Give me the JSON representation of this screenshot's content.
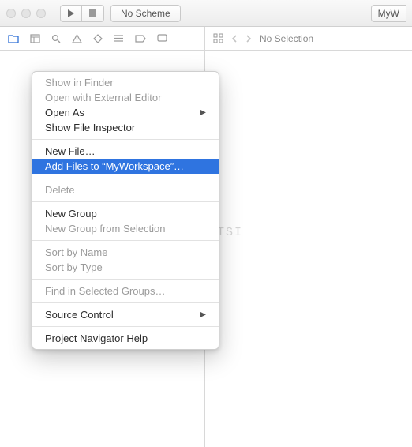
{
  "titlebar": {
    "scheme_label": "No Scheme",
    "right_pill": "MyW"
  },
  "jumpbar": {
    "no_selection": "No Selection"
  },
  "context_menu": {
    "items": [
      {
        "label": "Show in Finder",
        "dim": true
      },
      {
        "label": "Open with External Editor",
        "dim": true
      },
      {
        "label": "Open As",
        "submenu": true
      },
      {
        "label": "Show File Inspector"
      },
      {
        "sep": true
      },
      {
        "label": "New File…"
      },
      {
        "label": "Add Files to “MyWorkspace”…",
        "selected": true
      },
      {
        "sep": true
      },
      {
        "label": "Delete",
        "dim": true
      },
      {
        "sep": true
      },
      {
        "label": "New Group"
      },
      {
        "label": "New Group from Selection",
        "dim": true
      },
      {
        "sep": true
      },
      {
        "label": "Sort by Name",
        "dim": true
      },
      {
        "label": "Sort by Type",
        "dim": true
      },
      {
        "sep": true
      },
      {
        "label": "Find in Selected Groups…",
        "dim": true
      },
      {
        "sep": true
      },
      {
        "label": "Source Control",
        "submenu": true
      },
      {
        "sep": true
      },
      {
        "label": "Project Navigator Help"
      }
    ]
  },
  "watermark": "csdn.net/PRESISTSI"
}
